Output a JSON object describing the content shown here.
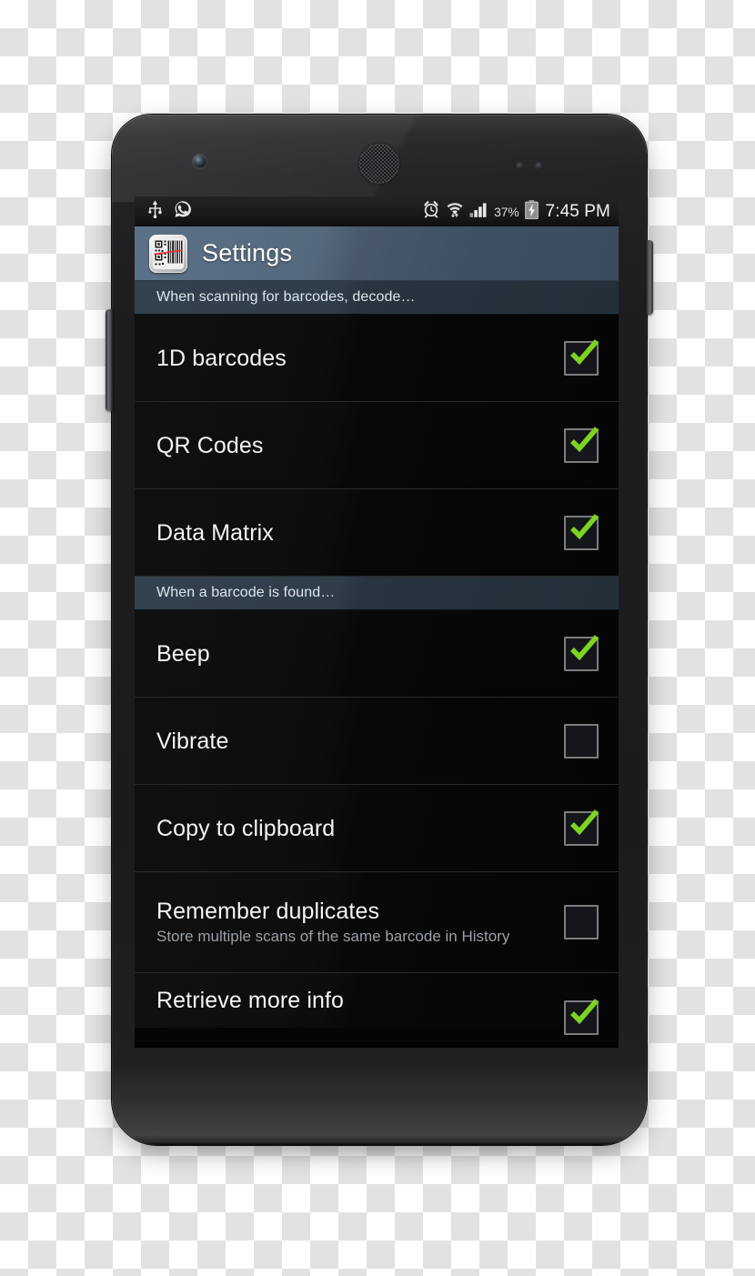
{
  "status_bar": {
    "left_icons": [
      "usb-icon",
      "whatsapp-icon"
    ],
    "right_icons": [
      "alarm-icon",
      "wifi-icon",
      "signal-icon",
      "battery-charging-icon"
    ],
    "battery_percent": "37%",
    "clock": "7:45 PM"
  },
  "action_bar": {
    "app_icon": "barcode-scanner-icon",
    "title": "Settings",
    "accent_color": "#4a5c70"
  },
  "list": [
    {
      "kind": "header",
      "label": "When scanning for barcodes, decode…"
    },
    {
      "kind": "item",
      "title": "1D barcodes",
      "subtitle": "",
      "checked": true
    },
    {
      "kind": "item",
      "title": "QR Codes",
      "subtitle": "",
      "checked": true
    },
    {
      "kind": "item",
      "title": "Data Matrix",
      "subtitle": "",
      "checked": true
    },
    {
      "kind": "header",
      "label": "When a barcode is found…"
    },
    {
      "kind": "item",
      "title": "Beep",
      "subtitle": "",
      "checked": true
    },
    {
      "kind": "item",
      "title": "Vibrate",
      "subtitle": "",
      "checked": false
    },
    {
      "kind": "item",
      "title": "Copy to clipboard",
      "subtitle": "",
      "checked": true
    },
    {
      "kind": "item",
      "title": "Remember duplicates",
      "subtitle": "Store multiple scans of the same barcode in History",
      "checked": false
    },
    {
      "kind": "item",
      "title": "Retrieve more info",
      "subtitle": "",
      "checked": true
    }
  ],
  "colors": {
    "checkbox_tick": "#7ed321",
    "checkbox_border": "#7d7d7d",
    "list_background": "#050505",
    "section_header_background": "#2b3844"
  },
  "rows": {
    "r1": {
      "title": "1D barcodes"
    },
    "r2": {
      "title": "QR Codes"
    },
    "r3": {
      "title": "Data Matrix"
    },
    "r4": {
      "title": "Beep"
    },
    "r5": {
      "title": "Vibrate"
    },
    "r6": {
      "title": "Copy to clipboard"
    },
    "r7": {
      "title": "Remember duplicates",
      "subtitle": "Store multiple scans of the same barcode in History"
    },
    "r8": {
      "title": "Retrieve more info"
    }
  },
  "headers": {
    "h1": "When scanning for barcodes, decode…",
    "h2": "When a barcode is found…"
  }
}
